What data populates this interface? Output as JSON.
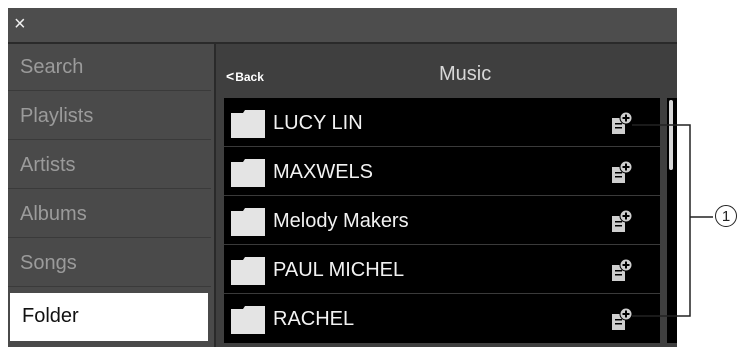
{
  "window": {
    "close_symbol": "×"
  },
  "sidebar": {
    "items": [
      {
        "label": "Search",
        "active": false
      },
      {
        "label": "Playlists",
        "active": false
      },
      {
        "label": "Artists",
        "active": false
      },
      {
        "label": "Albums",
        "active": false
      },
      {
        "label": "Songs",
        "active": false
      },
      {
        "label": "Folder",
        "active": true
      }
    ]
  },
  "header": {
    "back_label": "Back",
    "title": "Music"
  },
  "list": {
    "rows": [
      {
        "label": "LUCY LIN",
        "icon": "folder-icon",
        "action_icon": "add-to-playlist-icon"
      },
      {
        "label": "MAXWELS",
        "icon": "folder-icon",
        "action_icon": "add-to-playlist-icon"
      },
      {
        "label": "Melody Makers",
        "icon": "folder-icon",
        "action_icon": "add-to-playlist-icon"
      },
      {
        "label": "PAUL MICHEL",
        "icon": "folder-icon",
        "action_icon": "add-to-playlist-icon"
      },
      {
        "label": "RACHEL",
        "icon": "folder-icon",
        "action_icon": "add-to-playlist-icon"
      }
    ]
  },
  "annotation": {
    "callout_number": "1"
  },
  "colors": {
    "background": "#3f3f3f",
    "list_background": "#000000",
    "active_tab": "#ffffff"
  }
}
